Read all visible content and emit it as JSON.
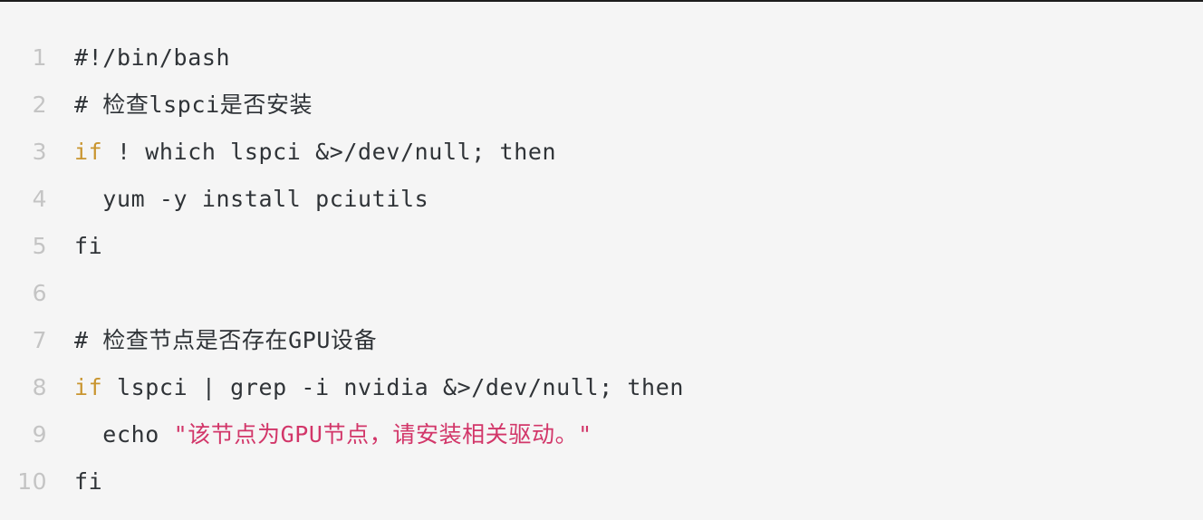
{
  "editor": {
    "name": "bash-code-viewer",
    "language": "bash",
    "background_color": "#f5f5f5",
    "line_number_color": "#c4c4c4",
    "text_color": "#2f3337",
    "keyword_color": "#c9952f",
    "string_color": "#d23669",
    "total_lines": 10
  },
  "lines": [
    {
      "number": "1",
      "text": "#!/bin/bash",
      "tokens": [
        {
          "text": "#!/bin/bash",
          "kind": "plain"
        }
      ]
    },
    {
      "number": "2",
      "text": "# 检查lspci是否安装",
      "tokens": [
        {
          "text": "# 检查lspci是否安装",
          "kind": "comment"
        }
      ]
    },
    {
      "number": "3",
      "text": "if ! which lspci &>/dev/null; then",
      "tokens": [
        {
          "text": "if",
          "kind": "keyword"
        },
        {
          "text": " ! which lspci &>/dev/null; then",
          "kind": "plain"
        }
      ]
    },
    {
      "number": "4",
      "text": "  yum -y install pciutils",
      "tokens": [
        {
          "text": "  yum -y install pciutils",
          "kind": "plain"
        }
      ]
    },
    {
      "number": "5",
      "text": "fi",
      "tokens": [
        {
          "text": "fi",
          "kind": "plain"
        }
      ]
    },
    {
      "number": "6",
      "text": "",
      "tokens": []
    },
    {
      "number": "7",
      "text": "# 检查节点是否存在GPU设备",
      "tokens": [
        {
          "text": "# 检查节点是否存在GPU设备",
          "kind": "comment"
        }
      ]
    },
    {
      "number": "8",
      "text": "if lspci | grep -i nvidia &>/dev/null; then",
      "tokens": [
        {
          "text": "if",
          "kind": "keyword"
        },
        {
          "text": " lspci | grep -i nvidia &>/dev/null; then",
          "kind": "plain"
        }
      ]
    },
    {
      "number": "9",
      "text": "  echo \"该节点为GPU节点，请安装相关驱动。\"",
      "tokens": [
        {
          "text": "  echo ",
          "kind": "plain"
        },
        {
          "text": "\"该节点为GPU节点，请安装相关驱动。\"",
          "kind": "string"
        }
      ]
    },
    {
      "number": "10",
      "text": "fi",
      "tokens": [
        {
          "text": "fi",
          "kind": "plain"
        }
      ]
    }
  ]
}
